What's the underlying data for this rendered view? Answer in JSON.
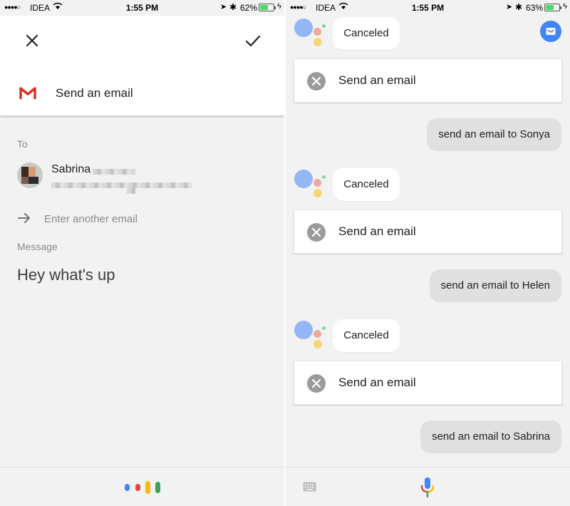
{
  "left": {
    "status": {
      "carrier": "IDEA",
      "time": "1:55 PM",
      "battery": "62%"
    },
    "header_title": "Send an email",
    "to_label": "To",
    "contact_name": "Sabrina",
    "enter_another_placeholder": "Enter another email",
    "message_label": "Message",
    "message_text": "Hey what's up",
    "google_dot_colors": [
      "#4285f4",
      "#ea4335",
      "#fbbc05",
      "#34a853"
    ]
  },
  "right": {
    "status": {
      "carrier": "IDEA",
      "time": "1:55 PM",
      "battery": "63%"
    },
    "conversation": [
      {
        "assistant": "Canceled",
        "card": "Send an email"
      },
      {
        "user": "send an email to Sonya"
      },
      {
        "assistant": "Canceled",
        "card": "Send an email"
      },
      {
        "user": "send an email to Helen"
      },
      {
        "assistant": "Canceled",
        "card": "Send an email"
      },
      {
        "user": "send an email to Sabrina"
      }
    ]
  },
  "icons": {
    "close": "close-icon",
    "confirm": "check-icon",
    "app": "gmail-icon",
    "arrow": "arrow-right-icon",
    "cancel_status": "cancel-circle-icon",
    "assistant": "google-assistant-icon",
    "keyboard": "keyboard-icon",
    "mic": "microphone-icon",
    "inbox": "inbox-icon"
  },
  "colors": {
    "assistant_blue": "#4285f4",
    "assistant_red": "#ea4335",
    "assistant_yellow": "#fbbc05",
    "assistant_green": "#34a853",
    "battery_green": "#4cd964"
  }
}
